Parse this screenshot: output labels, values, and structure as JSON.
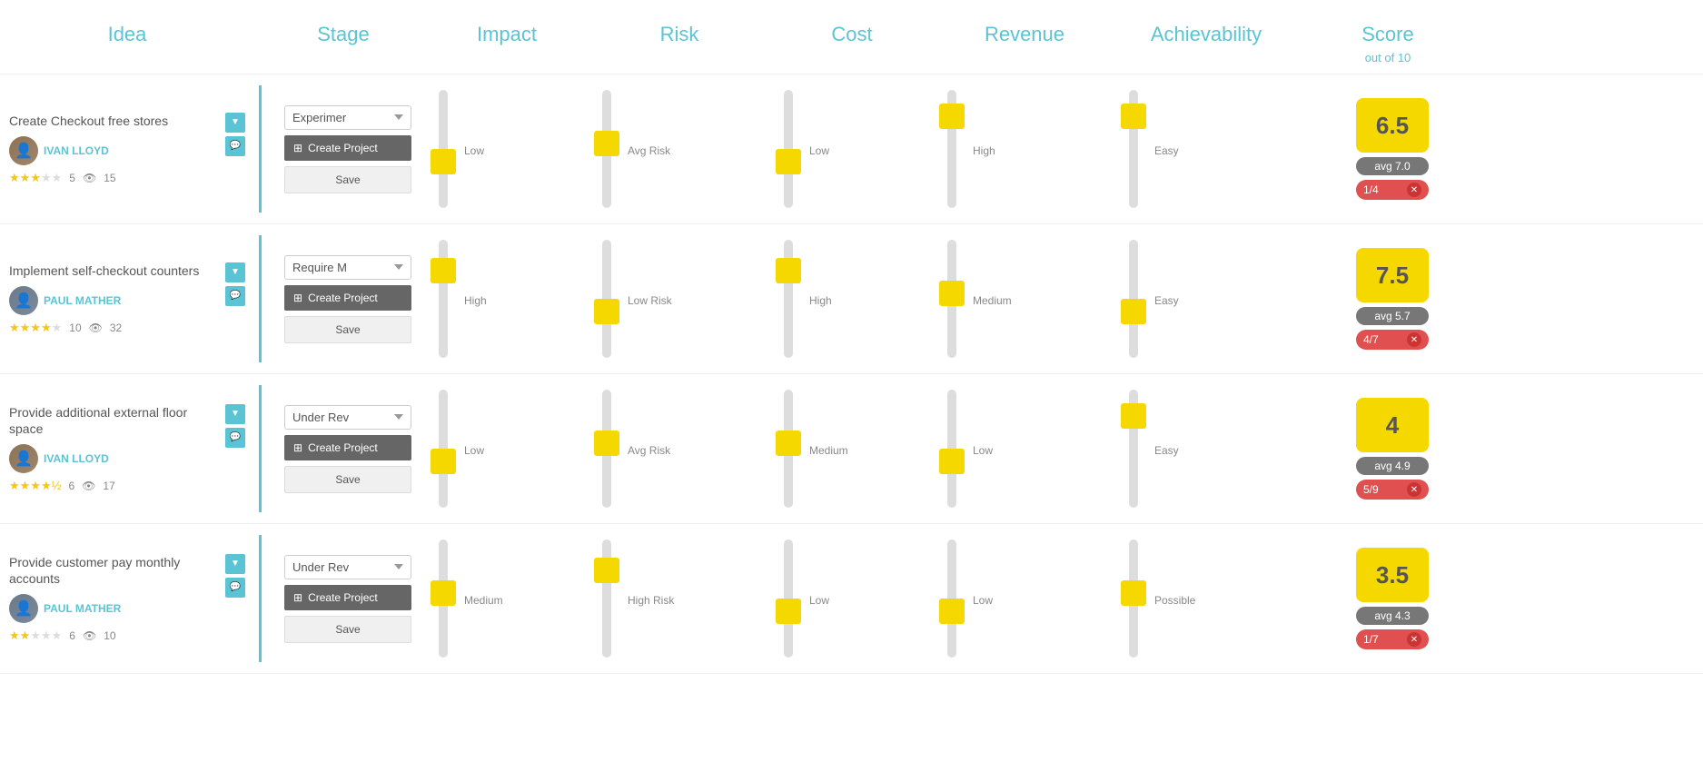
{
  "header": {
    "idea_label": "Idea",
    "stage_label": "Stage",
    "impact_label": "Impact",
    "risk_label": "Risk",
    "cost_label": "Cost",
    "revenue_label": "Revenue",
    "achievability_label": "Achievability",
    "score_label": "Score",
    "score_sublabel": "out of 10"
  },
  "rows": [
    {
      "id": "row1",
      "idea": {
        "title": "Create Checkout free stores",
        "author": "IVAN LLOYD",
        "author_type": "ivan",
        "stars": 3,
        "votes": 5,
        "views": 15
      },
      "stage": {
        "select_value": "Experimer",
        "create_btn": "Create Project",
        "save_btn": "Save"
      },
      "impact": {
        "position": 65,
        "label": "Low"
      },
      "risk": {
        "position": 45,
        "label": "Avg Risk"
      },
      "cost": {
        "position": 65,
        "label": "Low"
      },
      "revenue": {
        "position": 15,
        "label": "High"
      },
      "achievability": {
        "position": 15,
        "label": "Easy"
      },
      "score": {
        "main": "6.5",
        "avg": "avg 7.0",
        "rank": "1/4"
      }
    },
    {
      "id": "row2",
      "idea": {
        "title": "Implement self-checkout counters",
        "author": "PAUL MATHER",
        "author_type": "paul",
        "stars": 4,
        "votes": 10,
        "views": 32
      },
      "stage": {
        "select_value": "Require M",
        "create_btn": "Create Project",
        "save_btn": "Save"
      },
      "impact": {
        "position": 20,
        "label": "High"
      },
      "risk": {
        "position": 65,
        "label": "Low Risk"
      },
      "cost": {
        "position": 20,
        "label": "High"
      },
      "revenue": {
        "position": 45,
        "label": "Medium"
      },
      "achievability": {
        "position": 65,
        "label": "Easy"
      },
      "score": {
        "main": "7.5",
        "avg": "avg 5.7",
        "rank": "4/7"
      }
    },
    {
      "id": "row3",
      "idea": {
        "title": "Provide additional external floor space",
        "author": "IVAN LLOYD",
        "author_type": "ivan",
        "stars": 4,
        "votes": 6,
        "views": 17
      },
      "stage": {
        "select_value": "Under Rev",
        "create_btn": "Create Project",
        "save_btn": "Save"
      },
      "impact": {
        "position": 65,
        "label": "Low"
      },
      "risk": {
        "position": 45,
        "label": "Avg Risk"
      },
      "cost": {
        "position": 45,
        "label": "Medium"
      },
      "revenue": {
        "position": 65,
        "label": "Low"
      },
      "achievability": {
        "position": 15,
        "label": "Easy"
      },
      "score": {
        "main": "4",
        "avg": "avg 4.9",
        "rank": "5/9"
      }
    },
    {
      "id": "row4",
      "idea": {
        "title": "Provide customer pay monthly accounts",
        "author": "PAUL MATHER",
        "author_type": "paul",
        "stars": 2,
        "votes": 6,
        "views": 10
      },
      "stage": {
        "select_value": "Under Rev",
        "create_btn": "Create Project",
        "save_btn": "Save"
      },
      "impact": {
        "position": 45,
        "label": "Medium"
      },
      "risk": {
        "position": 20,
        "label": "High Risk"
      },
      "cost": {
        "position": 65,
        "label": "Low"
      },
      "revenue": {
        "position": 65,
        "label": "Low"
      },
      "achievability": {
        "position": 45,
        "label": "Possible"
      },
      "score": {
        "main": "3.5",
        "avg": "avg 4.3",
        "rank": "1/7"
      }
    }
  ]
}
